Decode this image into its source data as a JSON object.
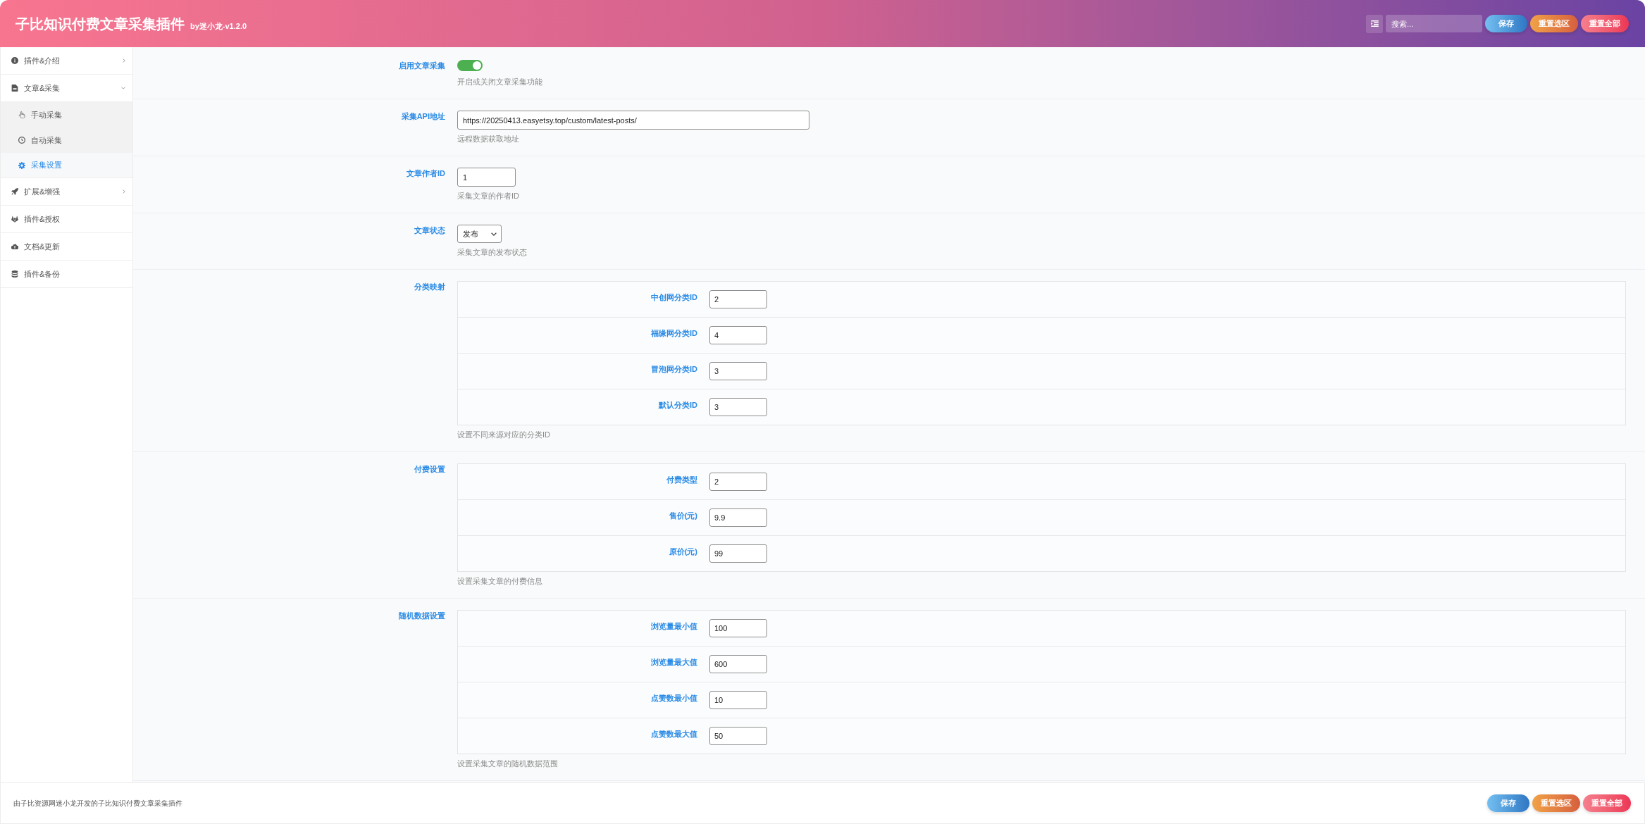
{
  "header": {
    "title": "子比知识付费文章采集插件",
    "version": "by迷小龙-v1.2.0",
    "search": {
      "placeholder": "搜索..."
    },
    "buttons": [
      {
        "label": "保存",
        "kind": "save"
      },
      {
        "label": "重置选区",
        "kind": "reset_section"
      },
      {
        "label": "重置全部",
        "kind": "reset_all"
      }
    ]
  },
  "sidebar": {
    "items": [
      {
        "label": "插件&介绍",
        "selected": false,
        "expanded": false
      },
      {
        "label": "文章&采集",
        "selected": false,
        "expanded": true,
        "children": [
          {
            "label": "手动采集",
            "selected": false
          },
          {
            "label": "自动采集",
            "selected": false
          },
          {
            "label": "采集设置",
            "selected": true
          }
        ]
      },
      {
        "label": "扩展&增强",
        "selected": false,
        "expanded": false
      },
      {
        "label": "插件&授权",
        "selected": false
      },
      {
        "label": "文档&更新",
        "selected": false
      },
      {
        "label": "插件&备份",
        "selected": false
      }
    ]
  },
  "fields": [
    {
      "kind": "switch",
      "label": "启用文章采集",
      "on": true,
      "description": "开启或关闭文章采集功能"
    },
    {
      "kind": "url",
      "label": "采集API地址",
      "value": "https://20250413.easyetsy.top/custom/latest-posts/",
      "description": "远程数据获取地址"
    },
    {
      "kind": "number",
      "label": "文章作者ID",
      "value": "1",
      "description": "采集文章的作者ID"
    },
    {
      "kind": "select",
      "label": "文章状态",
      "value": "发布",
      "description": "采集文章的发布状态"
    },
    {
      "kind": "group",
      "label": "分类映射",
      "fields": [
        {
          "label": "中创网分类ID",
          "value": "2"
        },
        {
          "label": "福缘网分类ID",
          "value": "4"
        },
        {
          "label": "冒泡网分类ID",
          "value": "3"
        },
        {
          "label": "默认分类ID",
          "value": "3"
        }
      ],
      "description": "设置不同来源对应的分类ID"
    },
    {
      "kind": "group",
      "label": "付费设置",
      "fields": [
        {
          "label": "付费类型",
          "value": "2"
        },
        {
          "label": "售价(元)",
          "value": "9.9"
        },
        {
          "label": "原价(元)",
          "value": "99"
        }
      ],
      "description": "设置采集文章的付费信息"
    },
    {
      "kind": "group",
      "label": "随机数据设置",
      "fields": [
        {
          "label": "浏览量最小值",
          "value": "100"
        },
        {
          "label": "浏览量最大值",
          "value": "600"
        },
        {
          "label": "点赞数最小值",
          "value": "10"
        },
        {
          "label": "点赞数最大值",
          "value": "50"
        }
      ],
      "description": "设置采集文章的随机数据范围"
    }
  ],
  "footer": {
    "text": "由子比资源网迷小龙开发的子比知识付费文章采集插件",
    "buttons": [
      {
        "label": "保存",
        "kind": "save"
      },
      {
        "label": "重置选区",
        "kind": "reset_section"
      },
      {
        "label": "重置全部",
        "kind": "reset_all"
      }
    ]
  }
}
